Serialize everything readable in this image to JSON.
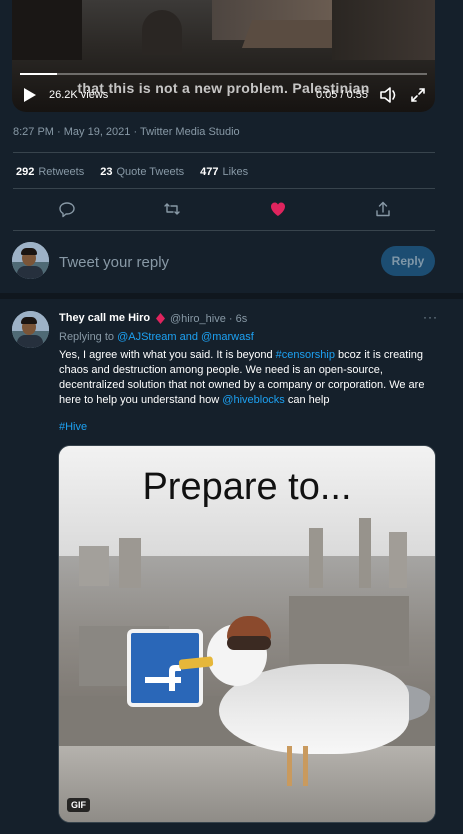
{
  "video": {
    "caption": "that this is not a new problem. Palestinian",
    "views": "26.2K views",
    "time": "0:05 / 0:55",
    "progress_fraction": 0.09
  },
  "meta": {
    "timestamp": "8:27 PM · May 19, 2021 · Twitter Media Studio"
  },
  "stats": {
    "retweets_count": "292",
    "retweets_label": "Retweets",
    "quote_count": "23",
    "quote_label": "Quote Tweets",
    "likes_count": "477",
    "likes_label": "Likes"
  },
  "actions": {
    "icons": [
      "reply-icon",
      "retweet-icon",
      "like-icon",
      "share-icon"
    ],
    "like_color": "#e0245e"
  },
  "composer": {
    "placeholder": "Tweet your reply",
    "button_label": "Reply"
  },
  "reply_tweet": {
    "name": "They call me Hiro",
    "handle": "@hiro_hive · 6s",
    "replying_prefix": "Replying to ",
    "mention_1": "@AJStream",
    "replying_and": " and ",
    "mention_2": "@marwasf",
    "body_part1": "Yes, I agree with what you said. It is beyond ",
    "body_link1": "#censorship",
    "body_part2": " bcoz it is creating chaos and destruction among people. We need is an open-source, decentralized solution that not owned by a company or corporation. We are here to help you understand how ",
    "body_link2": "@hiveblocks",
    "body_part3": " can help",
    "hashtag": "#Hive",
    "more": "···",
    "media": {
      "title": "Prepare to...",
      "badge": "GIF"
    }
  },
  "colors": {
    "background": "#15202b",
    "link": "#1da1f2",
    "muted": "#8899a6",
    "divider": "#38444d",
    "ruby": "#e0245e"
  }
}
